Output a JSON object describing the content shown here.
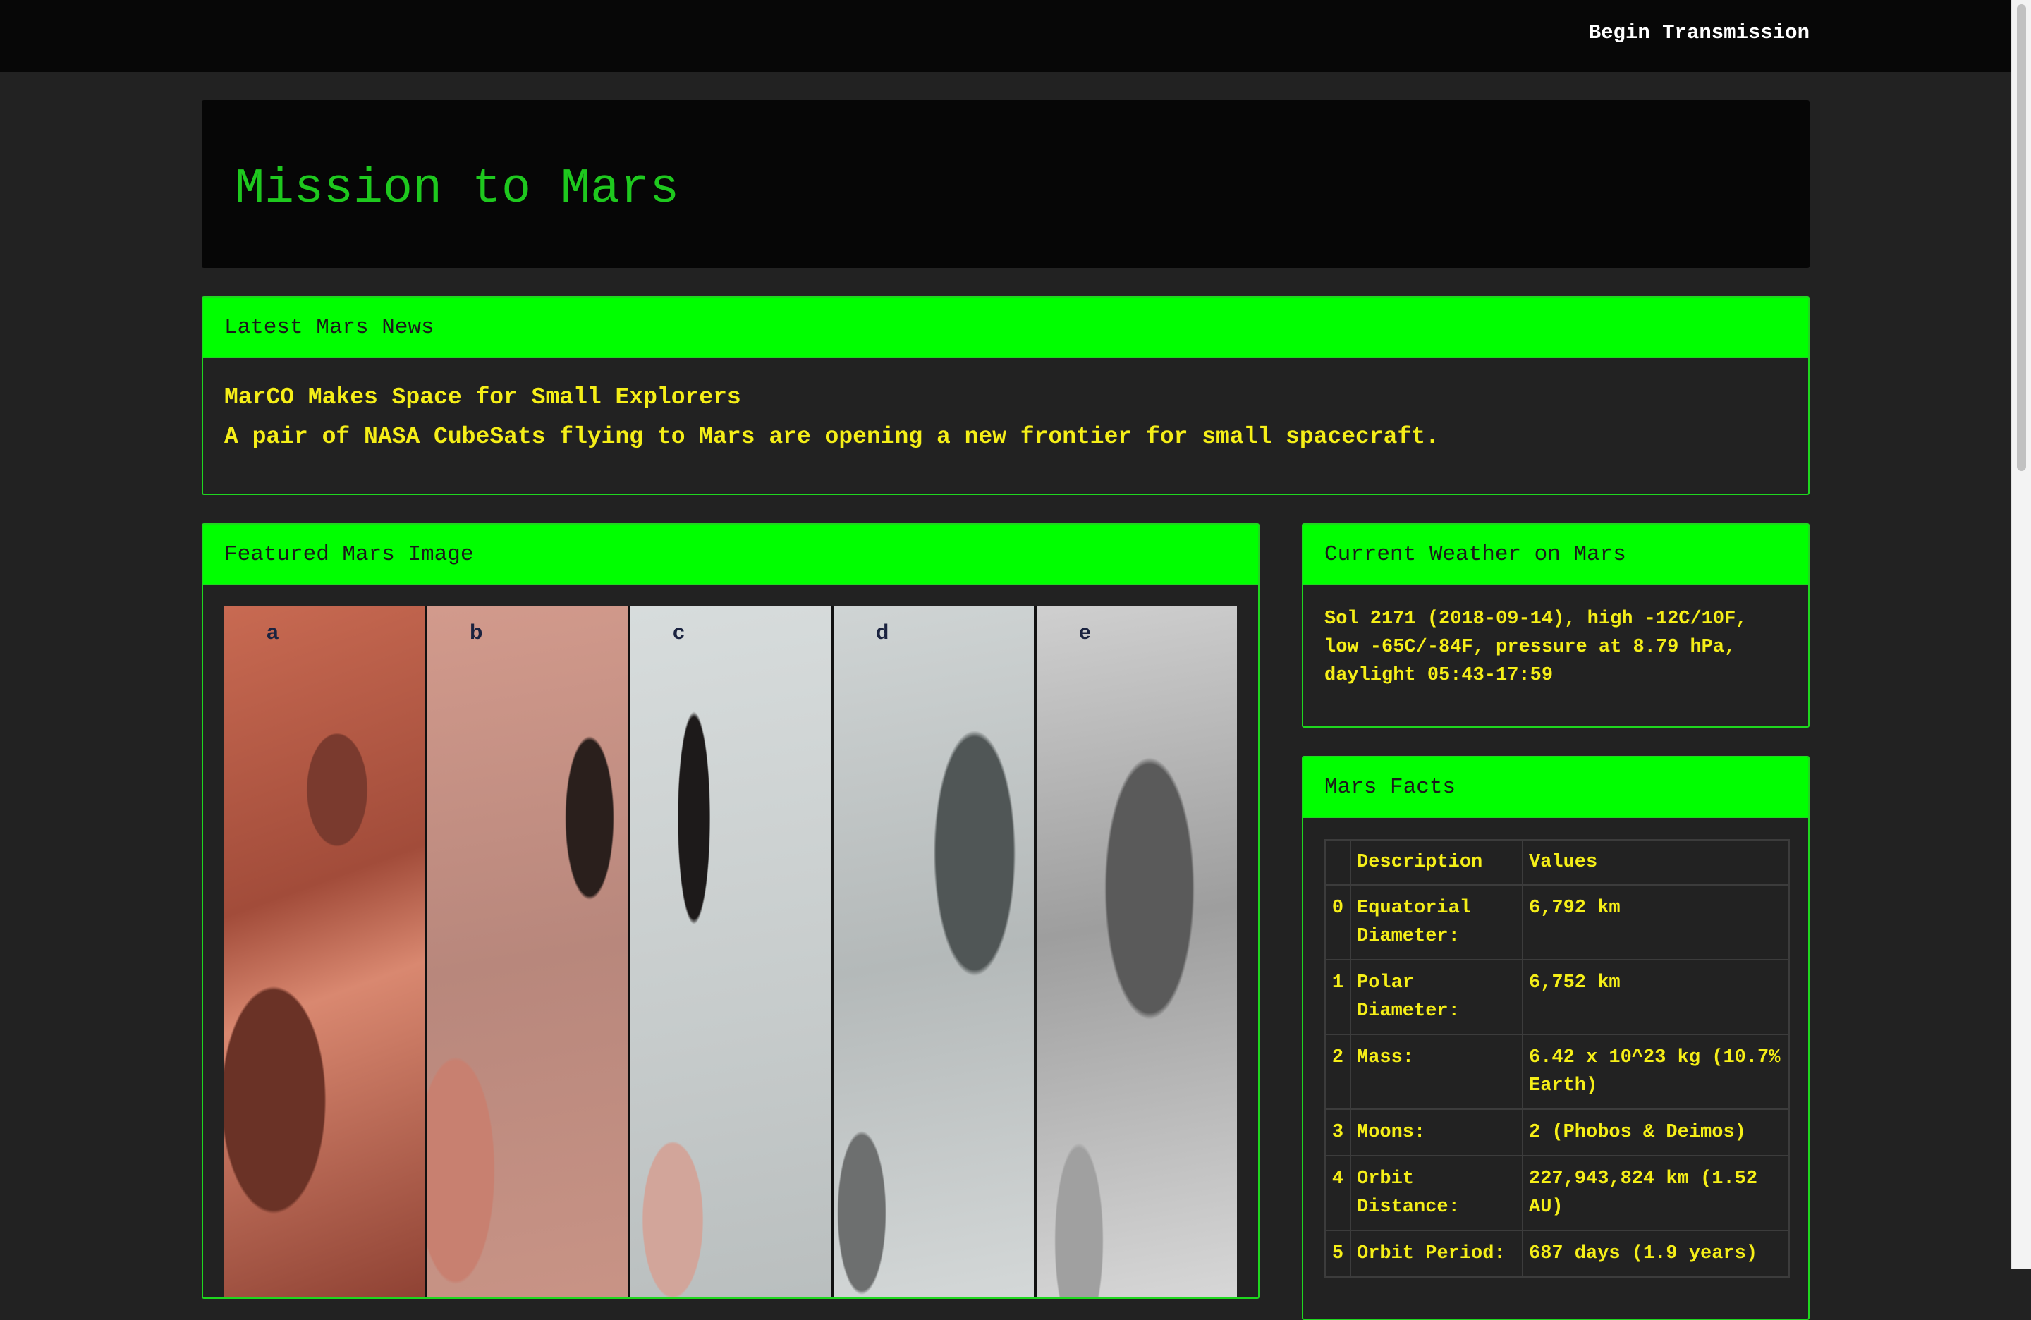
{
  "nav": {
    "begin_transmission": "Begin Transmission"
  },
  "hero": {
    "title": "Mission to Mars"
  },
  "news": {
    "heading": "Latest Mars News",
    "title": "MarCO Makes Space for Small Explorers",
    "teaser": "A pair of NASA CubeSats flying to Mars are opening a new frontier for small spacecraft."
  },
  "featured_image": {
    "heading": "Featured Mars Image",
    "panel_labels": [
      "a",
      "b",
      "c",
      "d",
      "e"
    ]
  },
  "weather": {
    "heading": "Current Weather on Mars",
    "text": "Sol 2171 (2018-09-14), high -12C/10F, low -65C/-84F, pressure at 8.79 hPa, daylight 05:43-17:59"
  },
  "facts": {
    "heading": "Mars Facts",
    "columns": [
      "",
      "Description",
      "Values"
    ],
    "rows": [
      {
        "index": "0",
        "description": "Equatorial Diameter:",
        "value": "6,792 km"
      },
      {
        "index": "1",
        "description": "Polar Diameter:",
        "value": "6,752 km"
      },
      {
        "index": "2",
        "description": "Mass:",
        "value": "6.42 x 10^23 kg (10.7% Earth)"
      },
      {
        "index": "3",
        "description": "Moons:",
        "value": "2 (Phobos & Deimos)"
      },
      {
        "index": "4",
        "description": "Orbit Distance:",
        "value": "227,943,824 km (1.52 AU)"
      },
      {
        "index": "5",
        "description": "Orbit Period:",
        "value": "687 days (1.9 years)"
      }
    ]
  },
  "colors": {
    "accent_green": "#00ff00",
    "title_green": "#1ec81e",
    "text_yellow": "#f5ee18",
    "background": "#222222"
  }
}
